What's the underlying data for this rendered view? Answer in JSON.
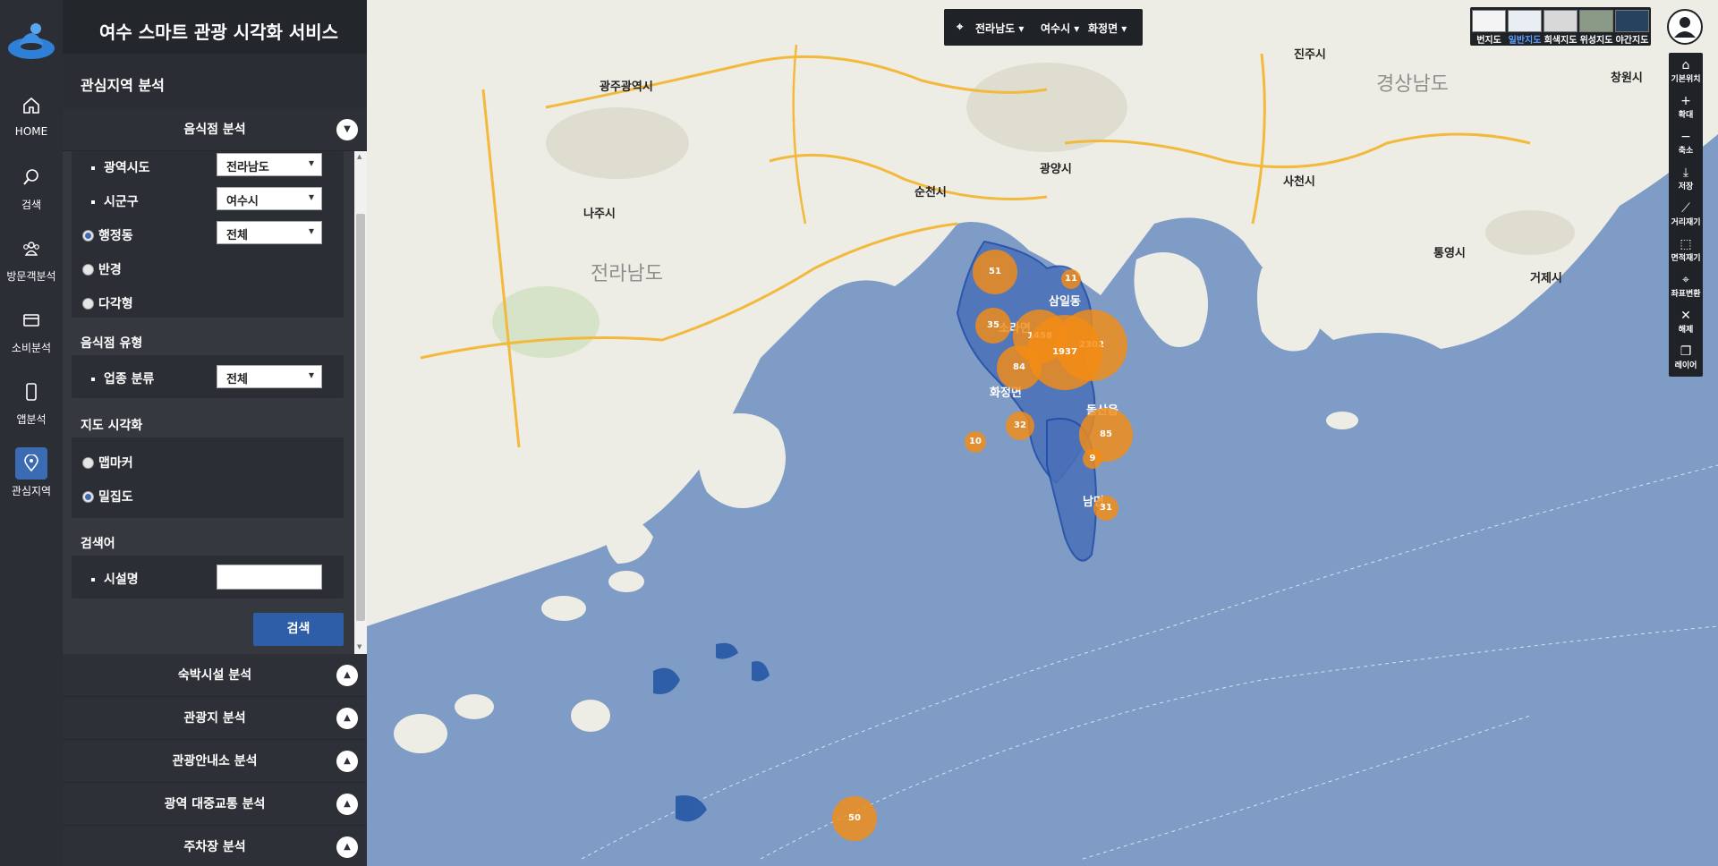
{
  "app": {
    "title": "여수 스마트 관광 시각화 서비스"
  },
  "nav": {
    "items": [
      {
        "label": "HOME",
        "icon": "home-icon"
      },
      {
        "label": "검색",
        "icon": "search-icon"
      },
      {
        "label": "방문객분석",
        "icon": "visitors-icon"
      },
      {
        "label": "소비분석",
        "icon": "card-icon"
      },
      {
        "label": "앱분석",
        "icon": "phone-icon"
      },
      {
        "label": "관심지역",
        "icon": "pin-icon",
        "active": true
      }
    ]
  },
  "panel": {
    "title": "관심지역 분석",
    "collapse_icon": "chevron-left-icon",
    "sections": {
      "restaurant": {
        "label": "음식점 분석",
        "fields": {
          "province_label": "광역시도",
          "province_value": "전라남도",
          "city_label": "시군구",
          "city_value": "여수시",
          "dong_label": "행정동",
          "dong_value": "전체",
          "radius_label": "반경",
          "polygon_label": "다각형"
        },
        "type_title": "음식점 유형",
        "category_label": "업종 분류",
        "category_value": "전체",
        "vis_title": "지도 시각화",
        "heatmarker_label": "맵마커",
        "density_label": "밀집도",
        "keyword_title": "검색어",
        "facility_label": "시설명",
        "facility_value": "",
        "search_button": "검색"
      },
      "collapsed": [
        "숙박시설 분석",
        "관광지 분석",
        "관광안내소 분석",
        "광역 대중교통 분석",
        "주차장 분석"
      ]
    }
  },
  "map": {
    "region": {
      "province": "전라남도",
      "city": "여수시",
      "dong": "화정면"
    },
    "layers": [
      {
        "label": "번지도"
      },
      {
        "label": "일반지도",
        "active": true
      },
      {
        "label": "회색지도"
      },
      {
        "label": "위성지도"
      },
      {
        "label": "야간지도"
      }
    ],
    "tools": [
      {
        "label": "기본위치",
        "icon": "home-icon"
      },
      {
        "label": "확대",
        "icon": "plus-icon"
      },
      {
        "label": "축소",
        "icon": "minus-icon"
      },
      {
        "label": "저장",
        "icon": "download-icon"
      },
      {
        "label": "거리재기",
        "icon": "ruler-icon"
      },
      {
        "label": "면적재기",
        "icon": "area-icon"
      },
      {
        "label": "좌표변환",
        "icon": "coordinate-icon"
      },
      {
        "label": "해제",
        "icon": "close-icon"
      },
      {
        "label": "레이어",
        "icon": "layers-icon"
      }
    ],
    "place_labels": {
      "gwangju": "광주광역시",
      "jeonnam": "전라남도",
      "gyeongnam": "경상남도",
      "suncheon": "순천시",
      "gwangyang": "광양시",
      "naju": "나주시",
      "jinju": "진주시",
      "sacheon": "사천시",
      "tongyeong": "통영시",
      "geoje": "거제시",
      "changwon": "창원시",
      "samil": "삼일동",
      "hwajeong": "화정면",
      "sora": "소라면",
      "dolsan": "돌산읍",
      "nam": "남면"
    },
    "clusters": [
      {
        "value": "51"
      },
      {
        "value": "11"
      },
      {
        "value": "35"
      },
      {
        "value": "1458"
      },
      {
        "value": "2302"
      },
      {
        "value": "1937"
      },
      {
        "value": "84"
      },
      {
        "value": "32"
      },
      {
        "value": "10"
      },
      {
        "value": "85"
      },
      {
        "value": "9"
      },
      {
        "value": "31"
      },
      {
        "value": "50"
      }
    ]
  }
}
